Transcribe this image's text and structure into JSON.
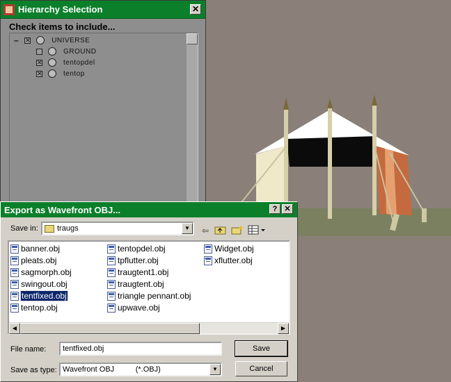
{
  "hierarchy": {
    "title": "Hierarchy Selection",
    "close_label": "✕",
    "heading": "Check items to include...",
    "tree": [
      {
        "label": "UNIVERSE",
        "checked": true,
        "expanded": true,
        "icon": "globe-icon"
      },
      {
        "label": "GROUND",
        "checked": false,
        "icon": "object-icon"
      },
      {
        "label": "tentopdel",
        "checked": true,
        "icon": "object-icon"
      },
      {
        "label": "tentop",
        "checked": true,
        "icon": "object-icon"
      }
    ]
  },
  "dialog": {
    "title": "Export as Wavefront OBJ...",
    "help_label": "?",
    "close_label": "✕",
    "save_in_label": "Save in:",
    "save_in_value": "traugs",
    "files": [
      [
        "banner.obj",
        "pleats.obj",
        "sagmorph.obj",
        "swingout.obj",
        "tentfixed.obj",
        "tentop.obj"
      ],
      [
        "tentopdel.obj",
        "tpflutter.obj",
        "traugtent1.obj",
        "traugtent.obj",
        "triangle pennant.obj",
        "upwave.obj"
      ],
      [
        "Widget.obj",
        "xflutter.obj"
      ]
    ],
    "selected_file": "tentfixed.obj",
    "file_name_label": "File name:",
    "file_name_value": "tentfixed.obj",
    "save_type_label": "Save as type:",
    "save_type_value": "Wavefront OBJ          (*.OBJ)",
    "save_label": "Save",
    "cancel_label": "Cancel"
  },
  "colors": {
    "titlebar": "#0b7f2a",
    "viewport_bg": "#8a8079",
    "selection": "#0a246a"
  }
}
